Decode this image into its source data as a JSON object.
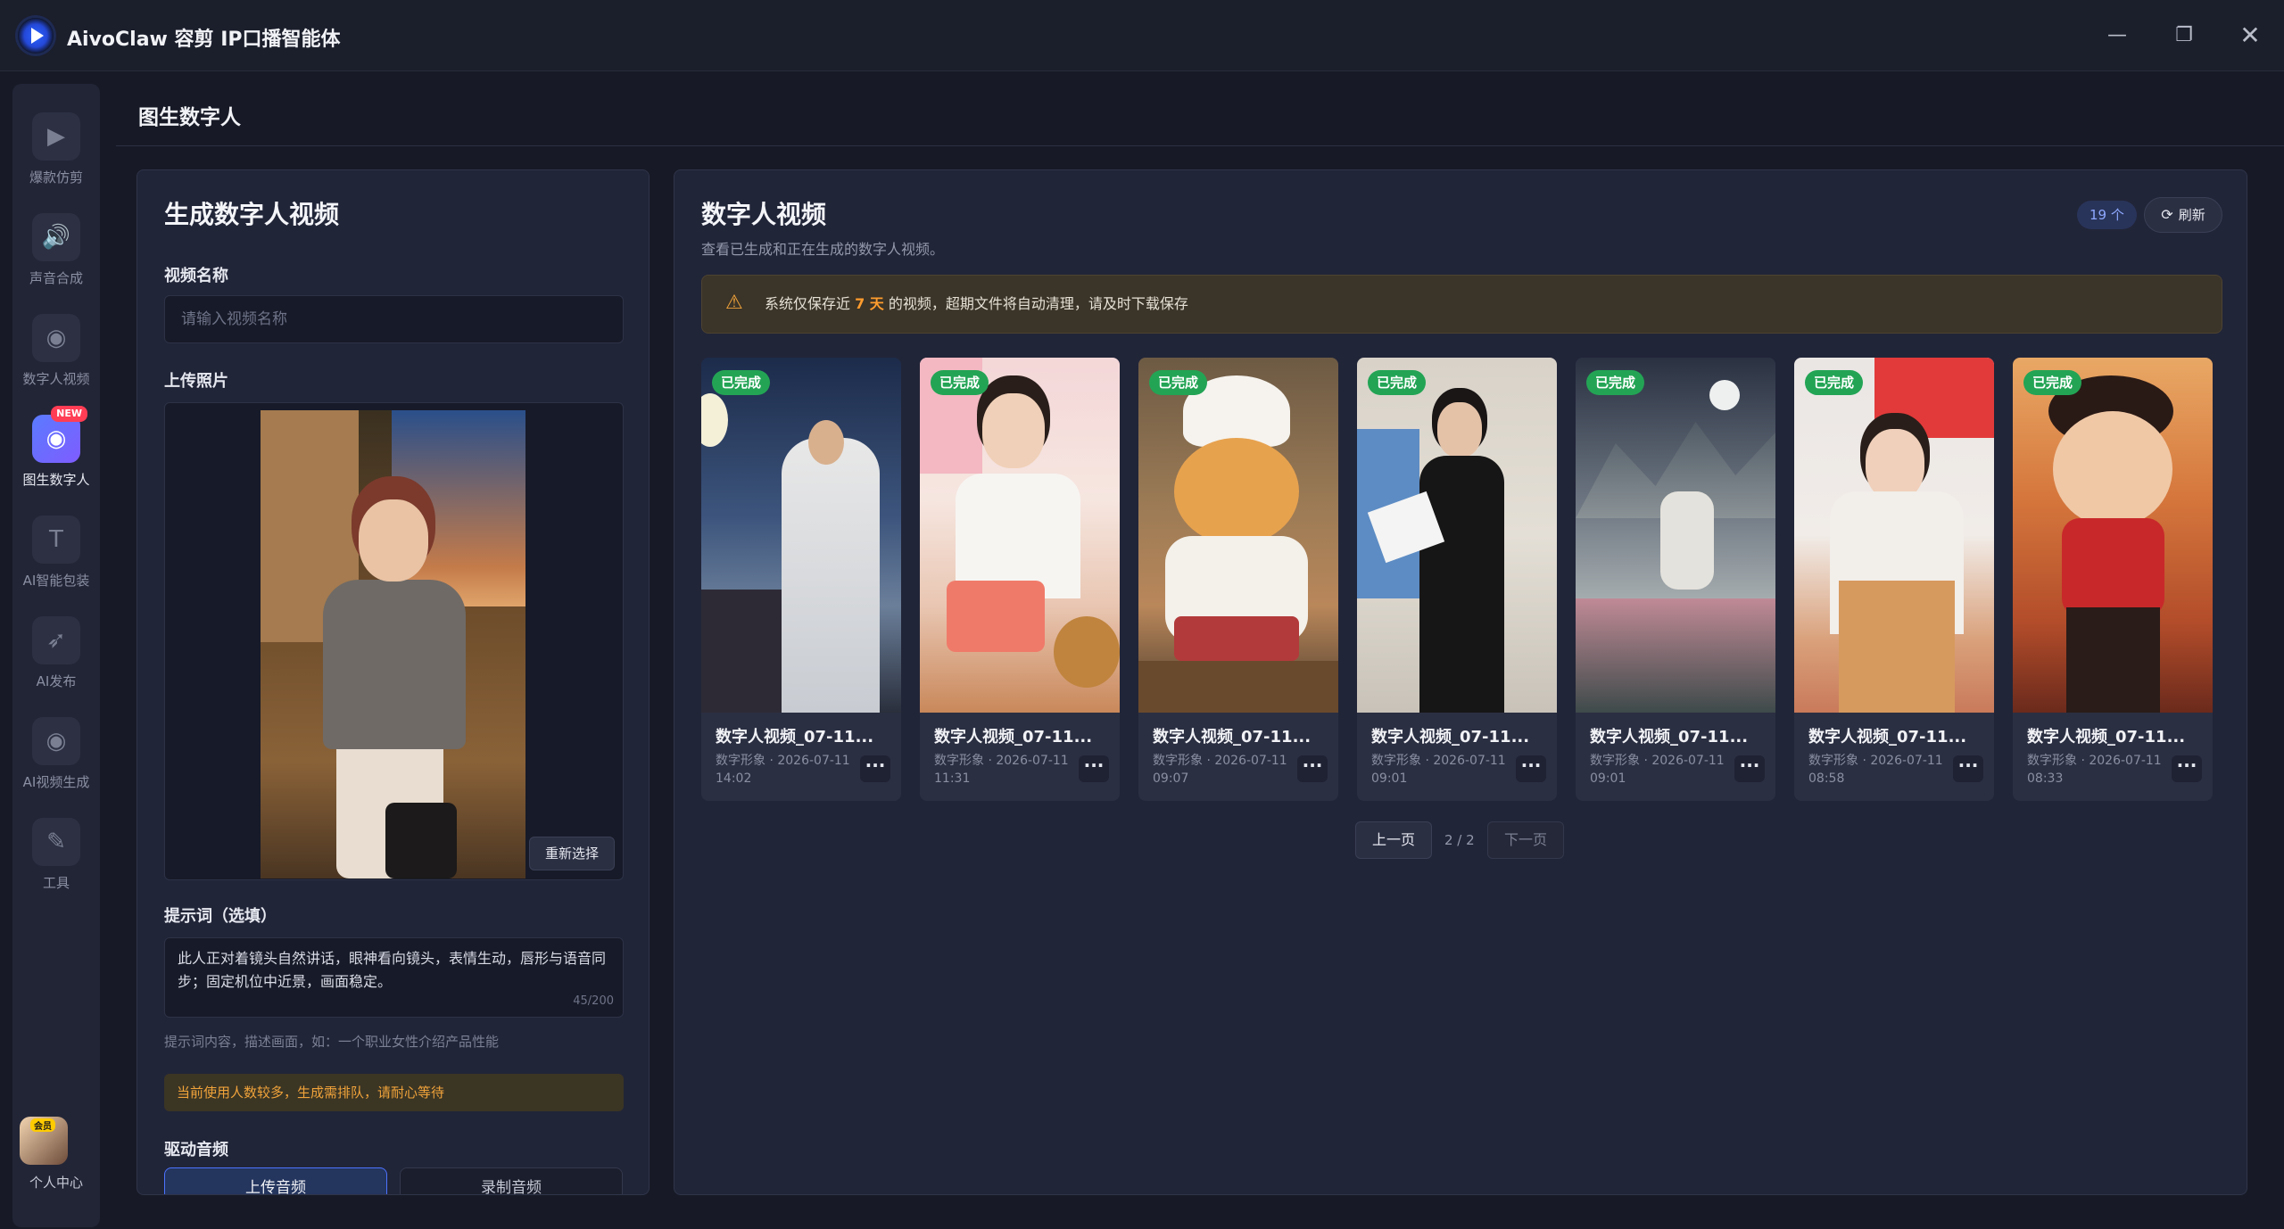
{
  "app": {
    "title": "AivoClaw 容剪 IP口播智能体"
  },
  "window_controls": {
    "minimize": "—",
    "maximize": "❐",
    "close": "✕"
  },
  "nav": {
    "items": [
      {
        "label": "爆款仿剪",
        "icon": "video-camera-icon",
        "glyph": "▶"
      },
      {
        "label": "声音合成",
        "icon": "speaker-icon",
        "glyph": "🔊"
      },
      {
        "label": "数字人视频",
        "icon": "digital-human-icon",
        "glyph": "◉"
      },
      {
        "label": "图生数字人",
        "icon": "image-human-icon",
        "glyph": "◉",
        "badge": "NEW"
      },
      {
        "label": "AI智能包装",
        "icon": "text-t-icon",
        "glyph": "T"
      },
      {
        "label": "AI发布",
        "icon": "rocket-icon",
        "glyph": "➶"
      },
      {
        "label": "AI视频生成",
        "icon": "video-gen-icon",
        "glyph": "◉"
      },
      {
        "label": "工具",
        "icon": "wrench-icon",
        "glyph": "✎"
      }
    ],
    "profile": {
      "label": "个人中心",
      "badge": "会员"
    }
  },
  "page": {
    "title": "图生数字人"
  },
  "generate": {
    "title": "生成数字人视频",
    "name_label": "视频名称",
    "name_placeholder": "请输入视频名称",
    "photo_label": "上传照片",
    "reselect": "重新选择",
    "prompt_label": "提示词（选填）",
    "prompt_value": "此人正对着镜头自然讲话，眼神看向镜头，表情生动，唇形与语音同步；固定机位中近景，画面稳定。",
    "prompt_count": "45/200",
    "prompt_hint": "提示词内容，描述画面，如：一个职业女性介绍产品性能",
    "queue_notice": "当前使用人数较多，生成需排队，请耐心等待",
    "audio_label": "驱动音频",
    "audio_tabs": [
      "上传音频",
      "录制音频"
    ]
  },
  "videos": {
    "title": "数字人视频",
    "subtitle": "查看已生成和正在生成的数字人视频。",
    "count": "19 个",
    "refresh": "刷新",
    "warning_pre": "系统仅保存近 ",
    "warning_days": "7 天",
    "warning_post": " 的视频，超期文件将自动清理，请及时下载保存",
    "cards": [
      {
        "status": "已完成",
        "title": "数字人视频_07-11...",
        "meta": "数字形象 · 2026-07-11",
        "time": "14:02"
      },
      {
        "status": "已完成",
        "title": "数字人视频_07-11...",
        "meta": "数字形象 · 2026-07-11",
        "time": "11:31"
      },
      {
        "status": "已完成",
        "title": "数字人视频_07-11...",
        "meta": "数字形象 · 2026-07-11",
        "time": "09:07"
      },
      {
        "status": "已完成",
        "title": "数字人视频_07-11...",
        "meta": "数字形象 · 2026-07-11",
        "time": "09:01"
      },
      {
        "status": "已完成",
        "title": "数字人视频_07-11...",
        "meta": "数字形象 · 2026-07-11",
        "time": "09:01"
      },
      {
        "status": "已完成",
        "title": "数字人视频_07-11...",
        "meta": "数字形象 · 2026-07-11",
        "time": "08:58"
      },
      {
        "status": "已完成",
        "title": "数字人视频_07-11...",
        "meta": "数字形象 · 2026-07-11",
        "time": "08:33"
      }
    ],
    "more": "···",
    "pagination": {
      "prev": "上一页",
      "info": "2 / 2",
      "next": "下一页"
    }
  },
  "colors": {
    "accent": "#4c73ff",
    "success": "#23a455",
    "warning": "#f0a33a"
  }
}
